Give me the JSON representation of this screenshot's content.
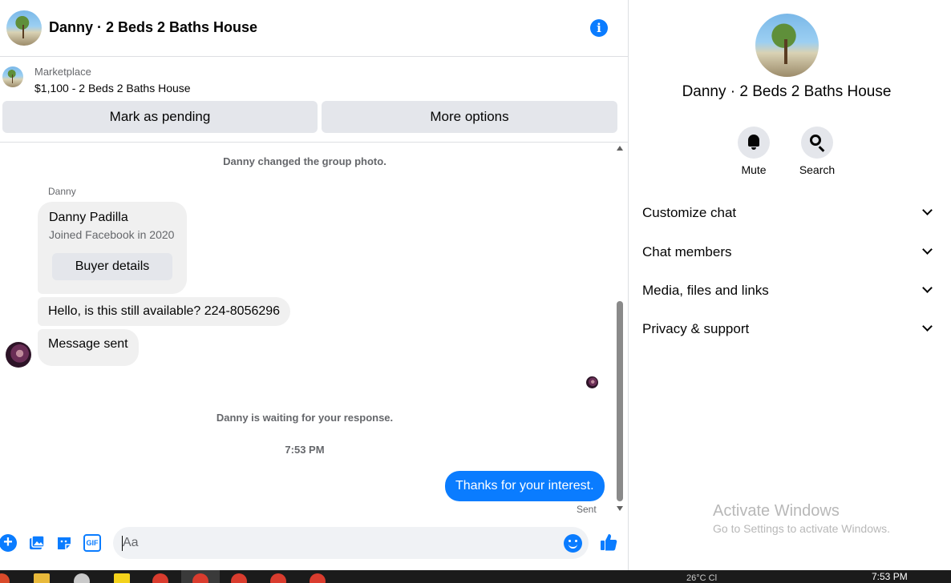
{
  "header": {
    "title": "Danny · 2 Beds 2 Baths House",
    "info_icon": "info-icon"
  },
  "listing": {
    "label": "Marketplace",
    "price_title": "$1,100 - 2 Beds 2 Baths House",
    "pending_button": "Mark as pending",
    "more_button": "More options"
  },
  "messages": {
    "system_photo": "Danny changed the group photo.",
    "sender": "Danny",
    "card": {
      "name": "Danny Padilla",
      "sub": "Joined Facebook in 2020",
      "button": "Buyer details"
    },
    "incoming_1": "Hello, is this still available? 224-8056296",
    "incoming_2": "Message sent",
    "system_waiting": "Danny is waiting for your response.",
    "timestamp": "7:53 PM",
    "outgoing": "Thanks for your interest.",
    "status": "Sent"
  },
  "composer": {
    "placeholder": "Aa",
    "gif": "GIF"
  },
  "details": {
    "title": "Danny · 2 Beds 2 Baths House",
    "actions": [
      {
        "label": "Mute",
        "icon": "bell-icon"
      },
      {
        "label": "Search",
        "icon": "search-icon"
      }
    ],
    "sections": [
      "Customize chat",
      "Chat members",
      "Media, files and links",
      "Privacy & support"
    ]
  },
  "watermark": {
    "line1": "Activate Windows",
    "line2": "Go to Settings to activate Windows."
  },
  "taskbar": {
    "time": "7:53 PM",
    "tray_text": "26°C  Cl"
  },
  "colors": {
    "accent": "#0a7cff",
    "bubble_in": "#f0f0f0",
    "button_bg": "#e4e6eb"
  }
}
